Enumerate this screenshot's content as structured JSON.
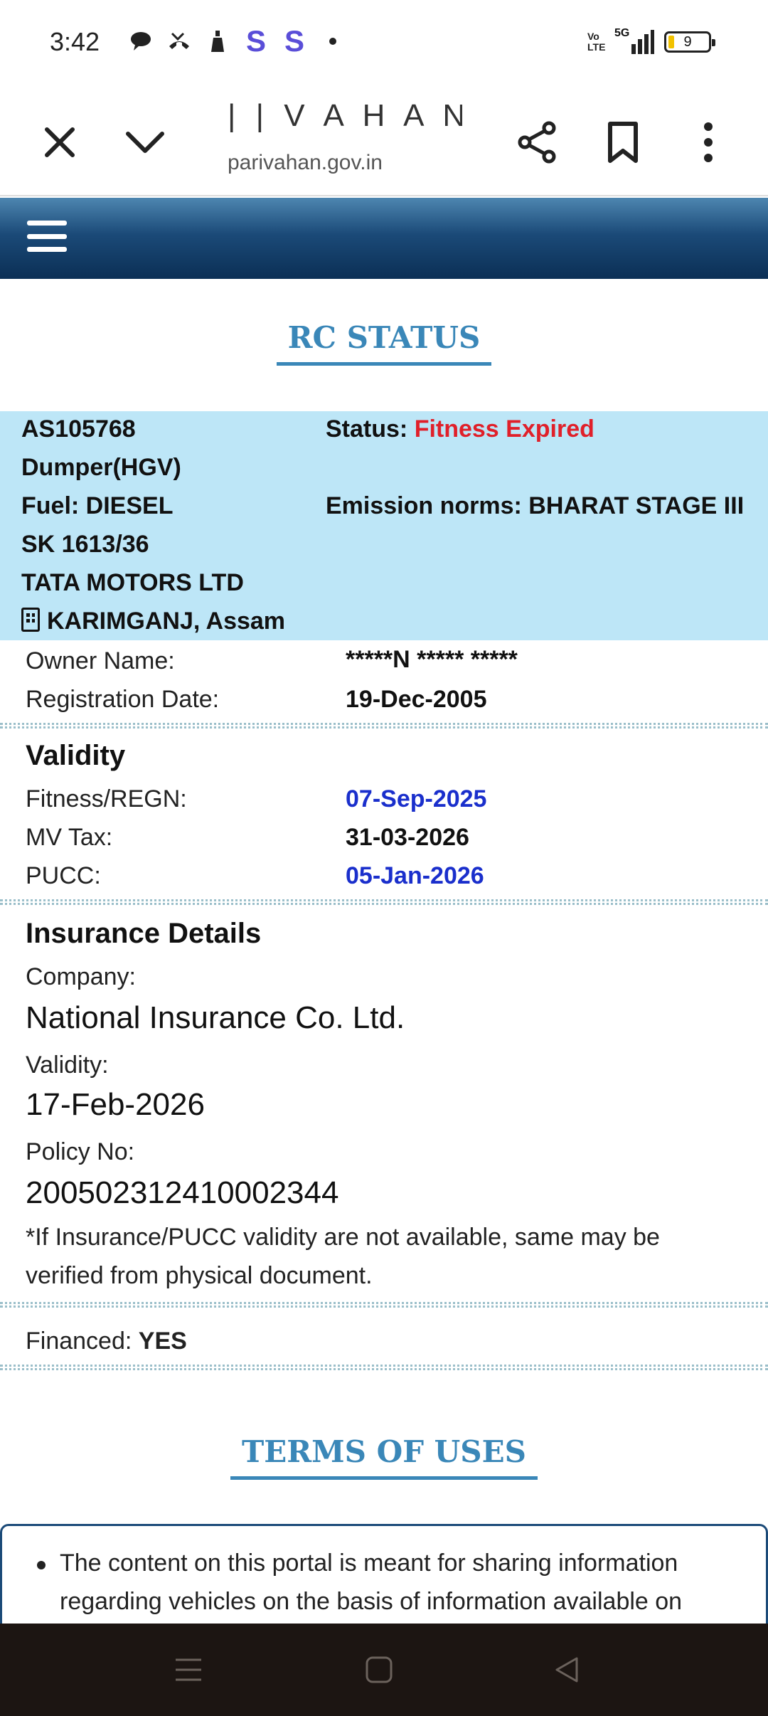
{
  "status_bar": {
    "time": "3:42",
    "notification_icons": [
      "chat-icon",
      "missed-call-icon",
      "bottle-icon",
      "s-app-icon",
      "s-app-icon",
      "dot-icon"
    ],
    "s_glyph": "S",
    "network": "5G",
    "volte": "Vo LTE",
    "battery": "9",
    "battery_color": "#f2c200"
  },
  "browser": {
    "title": "| | V A H A N | ...",
    "url": "parivahan.gov.in",
    "buttons": [
      "close-icon",
      "chevron-down-icon",
      "share-icon",
      "bookmark-icon",
      "more-vertical-icon"
    ]
  },
  "header": {
    "gradient_top": "#4d86b0",
    "gradient_bottom": "#0b2f55"
  },
  "rc_status": {
    "heading": "RC STATUS",
    "reg_no": "AS105768",
    "vehicle_class": "Dumper(HGV)",
    "fuel_label": "Fuel:",
    "fuel": "DIESEL",
    "model": "SK 1613/36",
    "maker": "TATA MOTORS LTD",
    "rto": "KARIMGANJ, Assam",
    "status_label": "Status:",
    "status": "Fitness Expired",
    "emission_label": "Emission norms:",
    "emission": "BHARAT STAGE III",
    "owner_label": "Owner Name:",
    "owner": "*****N ***** *****",
    "reg_date_label": "Registration Date:",
    "reg_date": "19-Dec-2005"
  },
  "validity": {
    "heading": "Validity",
    "fitness_label": "Fitness/REGN:",
    "fitness": "07-Sep-2025",
    "mvtax_label": "MV Tax:",
    "mvtax": "31-03-2026",
    "pucc_label": "PUCC:",
    "pucc": "05-Jan-2026"
  },
  "insurance": {
    "heading": "Insurance Details",
    "company_label": "Company:",
    "company": "National Insurance Co. Ltd.",
    "validity_label": "Validity:",
    "validity": "17-Feb-2026",
    "policy_label": "Policy No:",
    "policy": "200502312410002344",
    "note": "*If Insurance/PUCC validity are not available, same may be verified from physical document."
  },
  "finance": {
    "label": "Financed:",
    "value": "YES"
  },
  "terms": {
    "heading": "TERMS OF USES",
    "item1": "The content on this portal is meant for sharing information regarding vehicles on the basis of information available on"
  },
  "navbar": {
    "buttons": [
      "recents-icon",
      "home-icon",
      "back-icon"
    ]
  }
}
